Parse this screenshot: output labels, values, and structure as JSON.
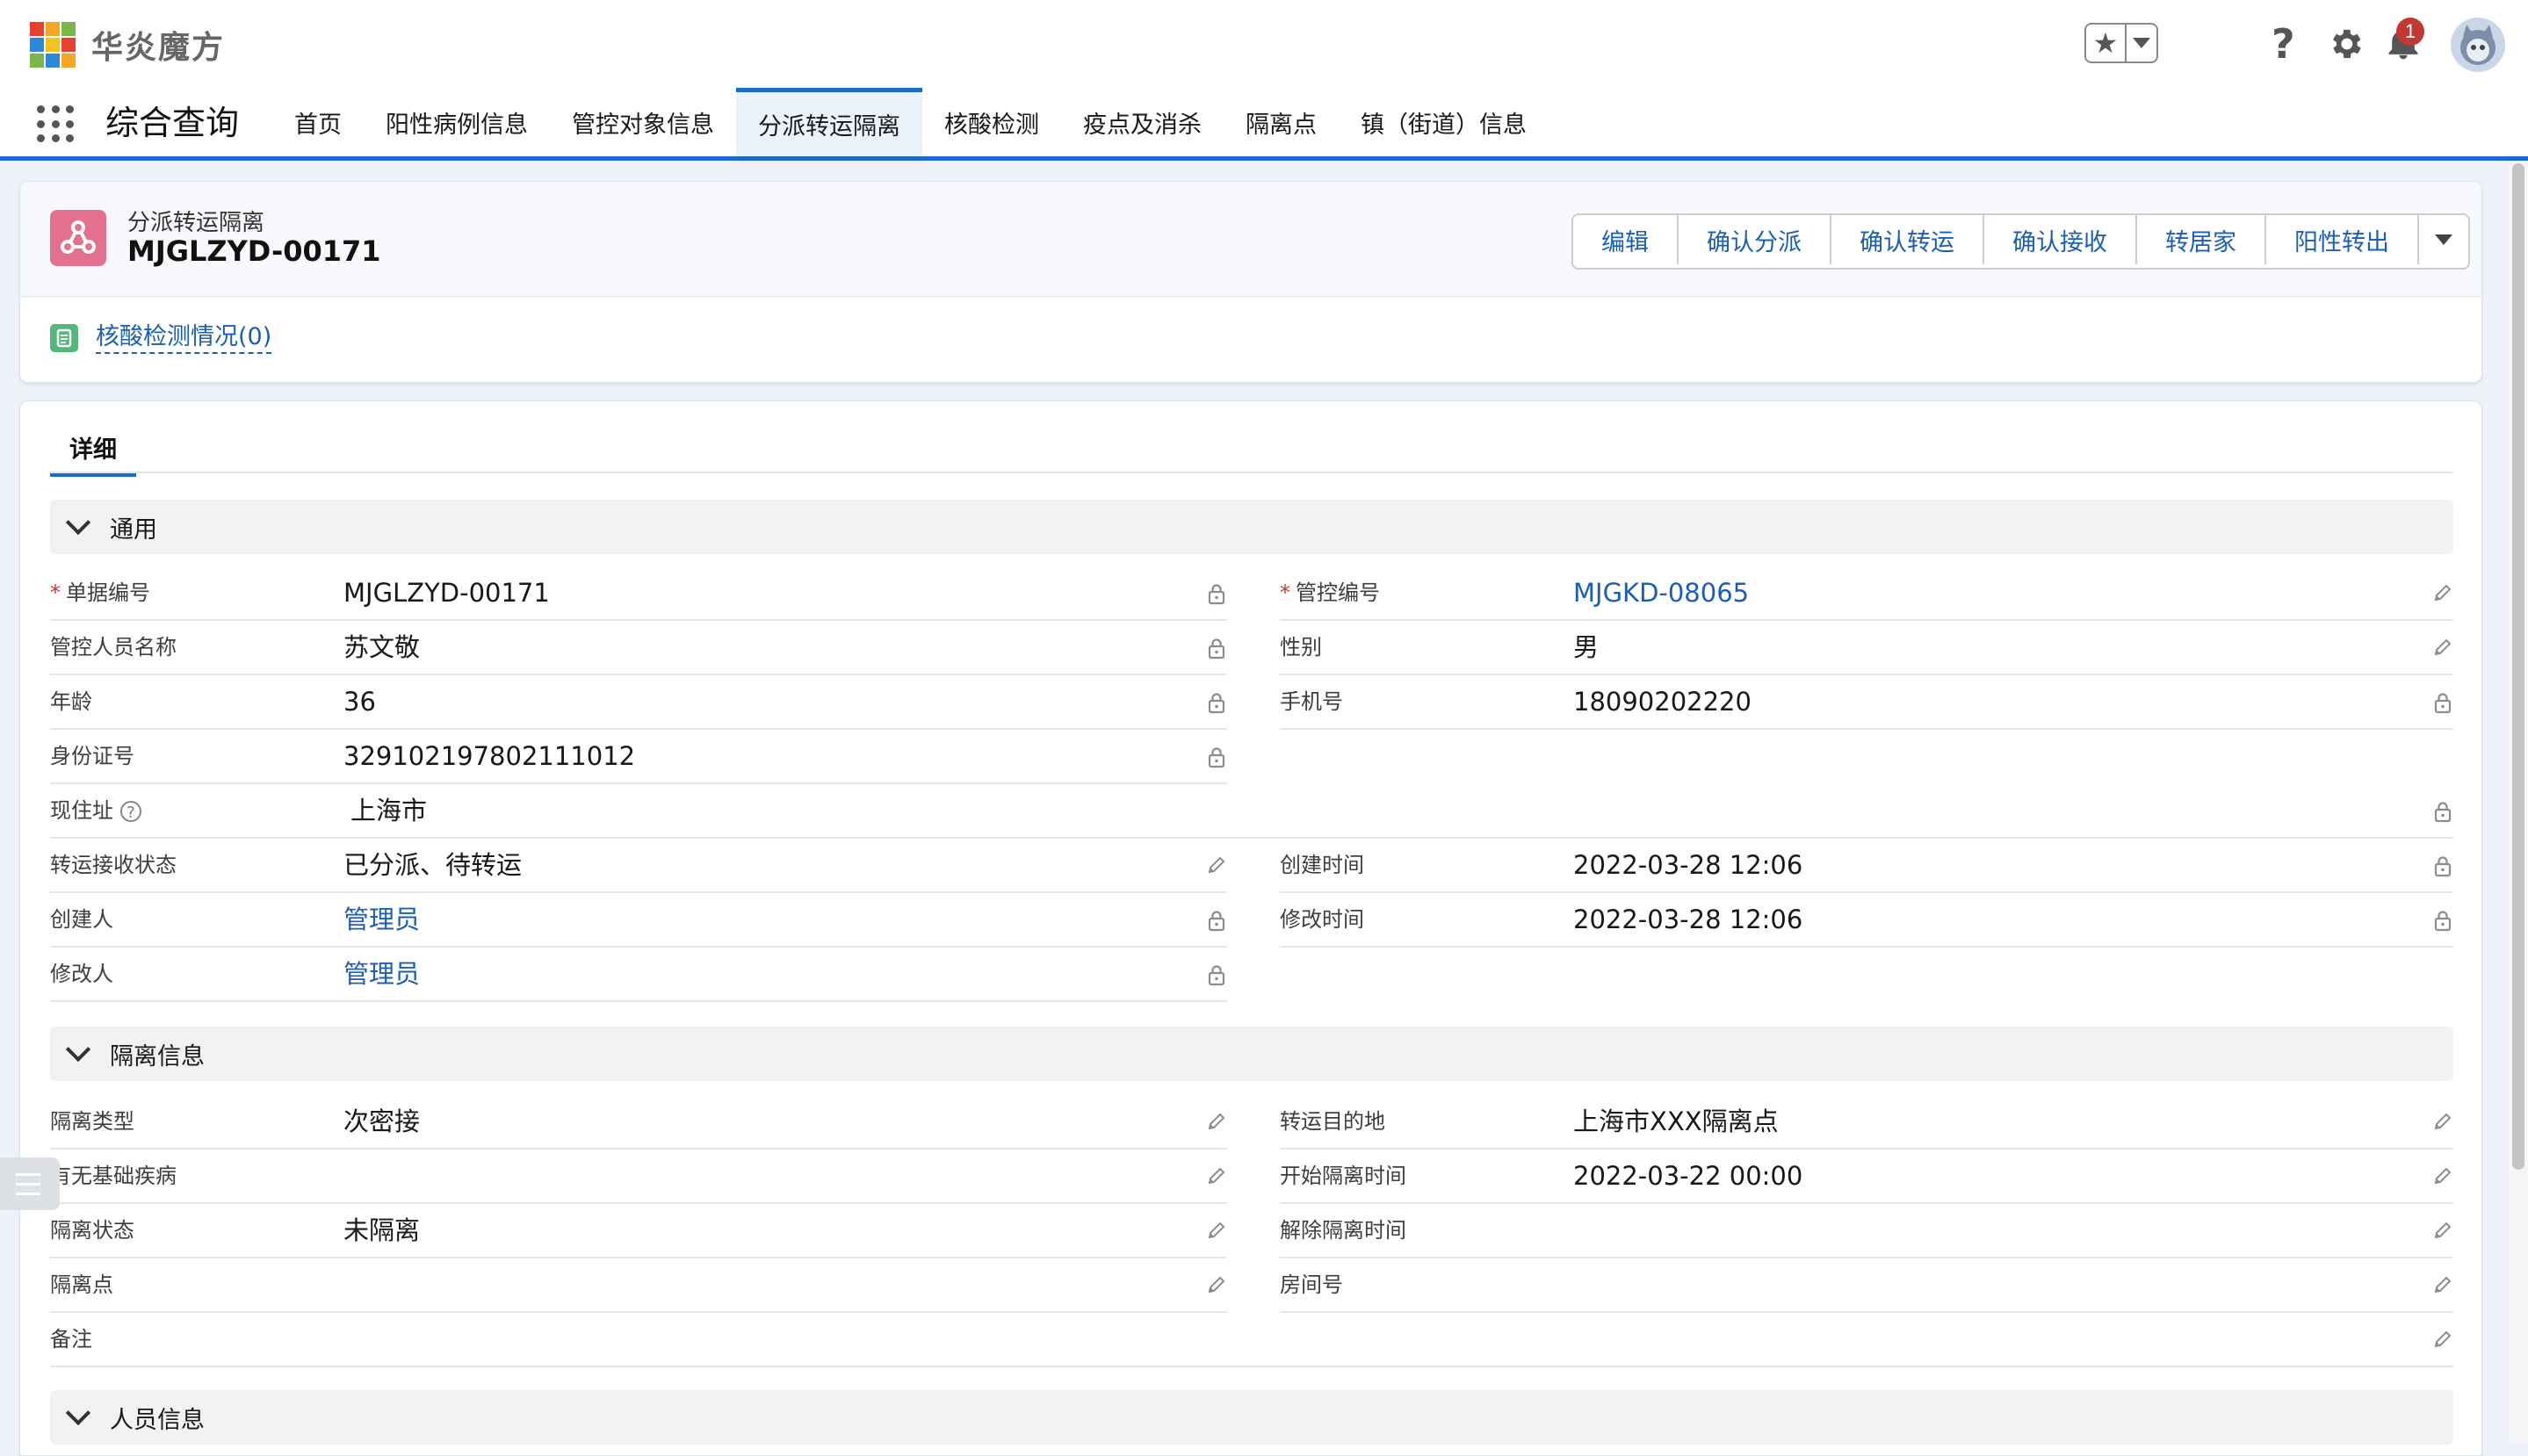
{
  "app": {
    "brand": "华炎魔方",
    "name": "综合查询",
    "notification_count": "1",
    "logo_colors": [
      "#e8402c",
      "#f5a623",
      "#7ab648",
      "#2c88d9",
      "#f0c419",
      "#e8402c",
      "#7ab648",
      "#2c88d9",
      "#f5a623"
    ]
  },
  "header_icons": {
    "favorites": "star-icon",
    "help": "?",
    "settings": "gear-icon",
    "notifications": "bell-icon",
    "avatar": "avatar-icon"
  },
  "nav": {
    "tabs": [
      {
        "label": "首页"
      },
      {
        "label": "阳性病例信息"
      },
      {
        "label": "管控对象信息"
      },
      {
        "label": "分派转运隔离",
        "active": true
      },
      {
        "label": "核酸检测"
      },
      {
        "label": "疫点及消杀"
      },
      {
        "label": "隔离点"
      },
      {
        "label": "镇（街道）信息"
      }
    ]
  },
  "record": {
    "type": "分派转运隔离",
    "title": "MJGLZYD-00171",
    "actions": [
      "编辑",
      "确认分派",
      "确认转运",
      "确认接收",
      "转居家",
      "阳性转出"
    ],
    "related_list": "核酸检测情况(0)"
  },
  "detail": {
    "tab": "详细",
    "sections": [
      {
        "label": "通用"
      },
      {
        "label": "隔离信息"
      },
      {
        "label": "人员信息"
      }
    ],
    "info_icon": "?"
  },
  "general": {
    "doc_no": {
      "label": "单据编号",
      "value": "MJGLZYD-00171"
    },
    "control_no": {
      "label": "管控编号",
      "value": "MJGKD-08065"
    },
    "person_name": {
      "label": "管控人员名称",
      "value": "苏文敬"
    },
    "gender": {
      "label": "性别",
      "value": "男"
    },
    "age": {
      "label": "年龄",
      "value": "36"
    },
    "phone": {
      "label": "手机号",
      "value": "18090202220"
    },
    "id_no": {
      "label": "身份证号",
      "value": "329102197802111012"
    },
    "address": {
      "label": "现住址",
      "value": "上海市"
    },
    "transfer_status": {
      "label": "转运接收状态",
      "value": "已分派、待转运"
    },
    "created_time": {
      "label": "创建时间",
      "value": "2022-03-28 12:06"
    },
    "creator": {
      "label": "创建人",
      "value": "管理员"
    },
    "modified_time": {
      "label": "修改时间",
      "value": "2022-03-28 12:06"
    },
    "modifier": {
      "label": "修改人",
      "value": "管理员"
    }
  },
  "isolation": {
    "type": {
      "label": "隔离类型",
      "value": "次密接"
    },
    "destination": {
      "label": "转运目的地",
      "value": "上海市XXX隔离点"
    },
    "disease": {
      "label": "有无基础疾病",
      "value": ""
    },
    "start_time": {
      "label": "开始隔离时间",
      "value": "2022-03-22 00:00"
    },
    "status": {
      "label": "隔离状态",
      "value": "未隔离"
    },
    "end_time": {
      "label": "解除隔离时间",
      "value": ""
    },
    "site": {
      "label": "隔离点",
      "value": ""
    },
    "room": {
      "label": "房间号",
      "value": ""
    },
    "remark": {
      "label": "备注",
      "value": ""
    }
  },
  "colors": {
    "accent": "#1b6ad0",
    "link": "#1b5fb5",
    "required": "#c23934",
    "record_icon": "#e3708e",
    "related_icon": "#54b87a"
  }
}
